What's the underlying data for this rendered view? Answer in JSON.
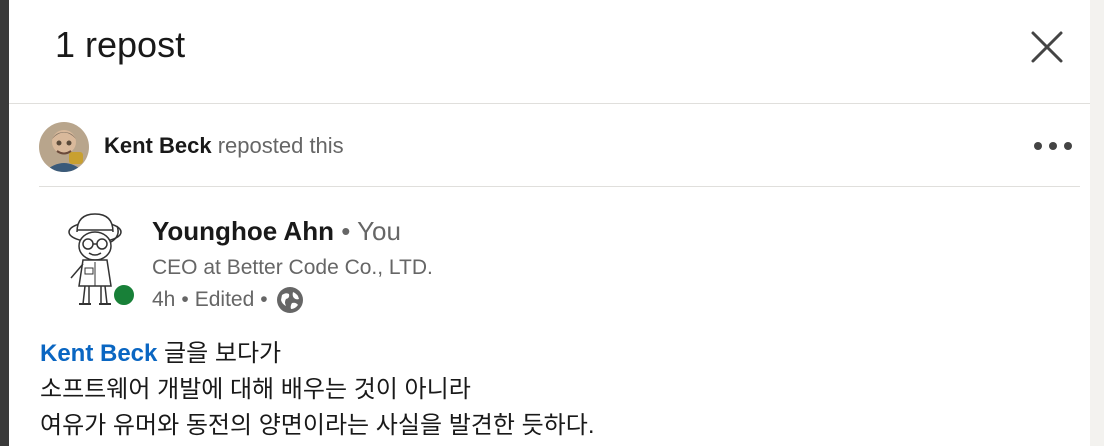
{
  "modal": {
    "title": "1 repost",
    "close_icon": "close-icon"
  },
  "repost": {
    "reposter_name": "Kent Beck",
    "action_text": "reposted this",
    "more_icon": "more-icon"
  },
  "post": {
    "author_name": "Younghoe Ahn",
    "separator": "•",
    "relationship": "You",
    "headline": "CEO at Better Code Co., LTD.",
    "time": "4h",
    "edited": "Edited",
    "visibility_icon": "globe-icon",
    "online_status_color": "#188038",
    "body": {
      "mention": "Kent Beck",
      "line1_rest": "글을 보다가",
      "line2": "소프트웨어 개발에 대해 배우는 것이 아니라",
      "line3": "여유가 유머와 동전의 양면이라는 사실을 발견한 듯하다."
    }
  },
  "colors": {
    "link": "#0a66c2",
    "text_primary": "#191919",
    "text_secondary": "#666666",
    "divider": "#e0dfdc"
  }
}
